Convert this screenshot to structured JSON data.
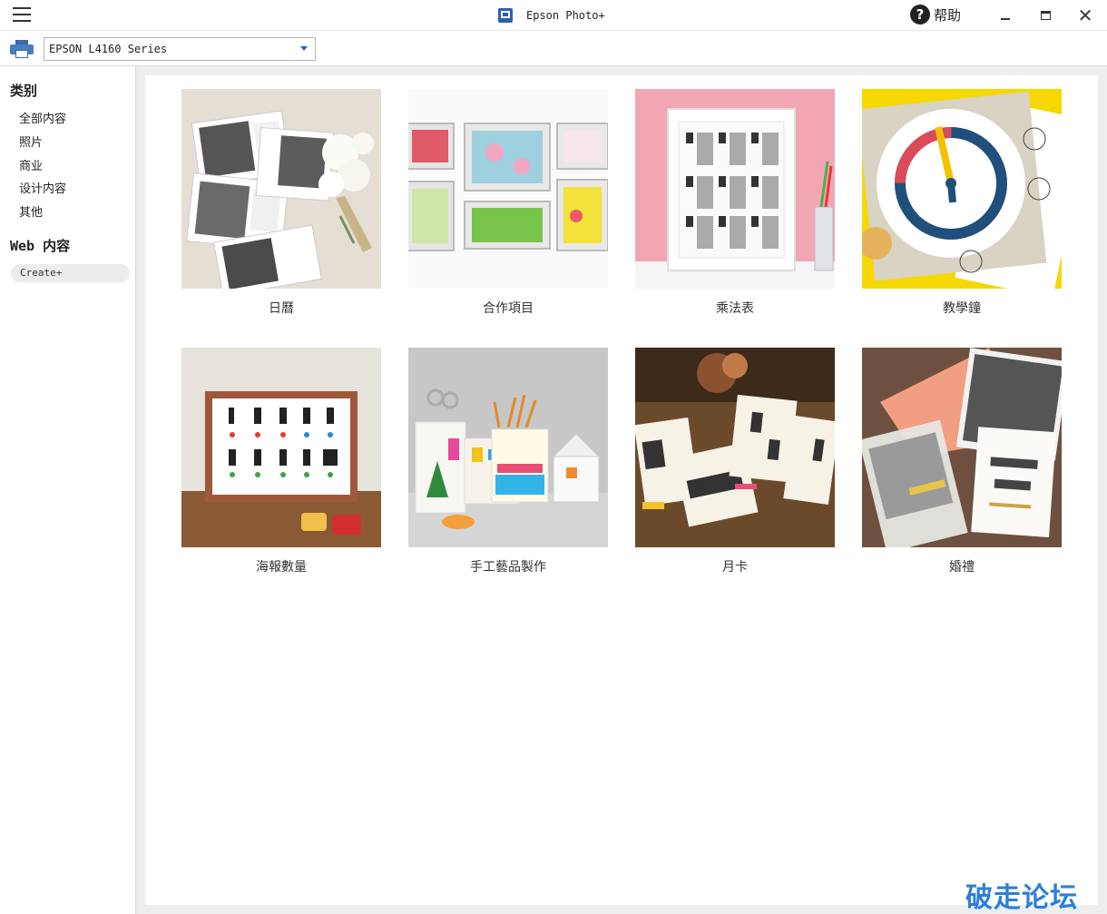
{
  "titlebar": {
    "app_title": "Epson Photo+",
    "help_label": "帮助",
    "icons": {
      "menu": "hamburger-menu-icon",
      "app": "epson-photo-app-icon",
      "help": "question-circle-icon",
      "minimize": "minimize-icon",
      "maximize": "maximize-icon",
      "close": "close-icon"
    },
    "close_glyph": "✕"
  },
  "printer": {
    "selected": "EPSON L4160 Series",
    "icon": "printer-icon"
  },
  "sidebar": {
    "category_heading": "类别",
    "categories": [
      "全部内容",
      "照片",
      "商业",
      "设计内容",
      "其他"
    ],
    "web_heading": "Web 内容",
    "web_items": [
      "Create+"
    ]
  },
  "grid": {
    "tiles": [
      {
        "label": "日曆"
      },
      {
        "label": "合作項目"
      },
      {
        "label": "乘法表"
      },
      {
        "label": "教學鐘"
      },
      {
        "label": "海報數量"
      },
      {
        "label": "手工藝品製作"
      },
      {
        "label": "月卡"
      },
      {
        "label": "婚禮"
      }
    ]
  },
  "watermark": "破走论坛",
  "colors": {
    "accent": "#2b5fb0",
    "content_bg": "#eceef0",
    "watermark": "#2e7fd6"
  }
}
